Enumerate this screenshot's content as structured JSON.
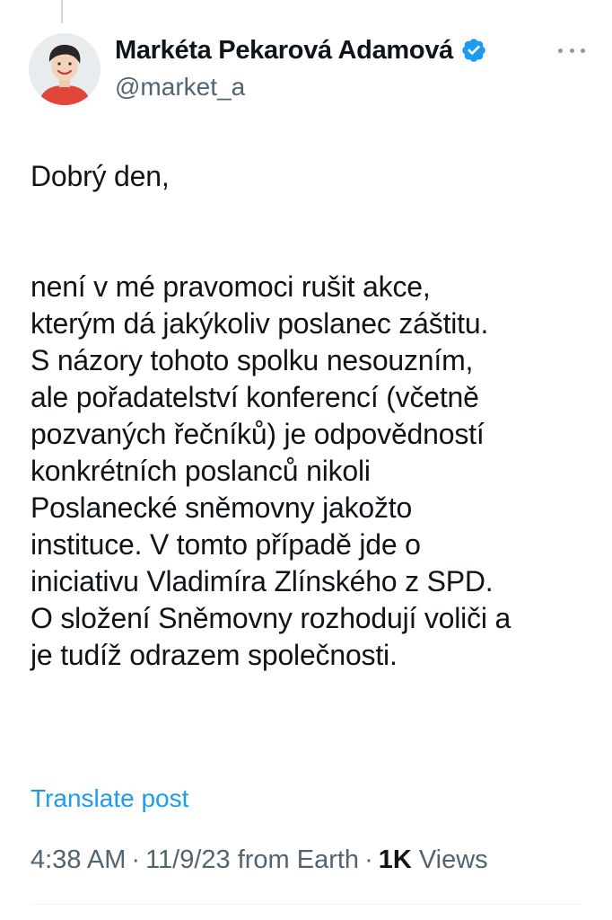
{
  "author": {
    "display_name": "Markéta Pekarová Adamová",
    "handle": "@market_a",
    "verified_color": "#1d9bf0",
    "avatar_icon": "profile-photo"
  },
  "tweet": {
    "paragraph_1": [
      "Dobrý den,"
    ],
    "paragraph_2": [
      "není v mé pravomoci rušit akce,",
      "kterým dá jakýkoliv poslanec záštitu.",
      "S názory tohoto spolku nesouzním,",
      "ale pořadatelství konferencí (včetně",
      "pozvaných řečníků) je odpovědností",
      "konkrétních poslanců nikoli",
      "Poslanecké sněmovny jakožto",
      "instituce. V tomto případě jde o",
      "iniciativu Vladimíra Zlínského z SPD.",
      "O složení Sněmovny rozhodují voliči a",
      "je tudíž odrazem společnosti."
    ]
  },
  "actions": {
    "translate_label": "Translate post"
  },
  "meta": {
    "time": "4:38 AM",
    "separator": "·",
    "date": "11/9/23",
    "source": "from Earth",
    "views_count": "1K",
    "views_label": "Views"
  },
  "colors": {
    "text": "#0f1419",
    "secondary": "#536471",
    "link": "#1d9bf0"
  }
}
